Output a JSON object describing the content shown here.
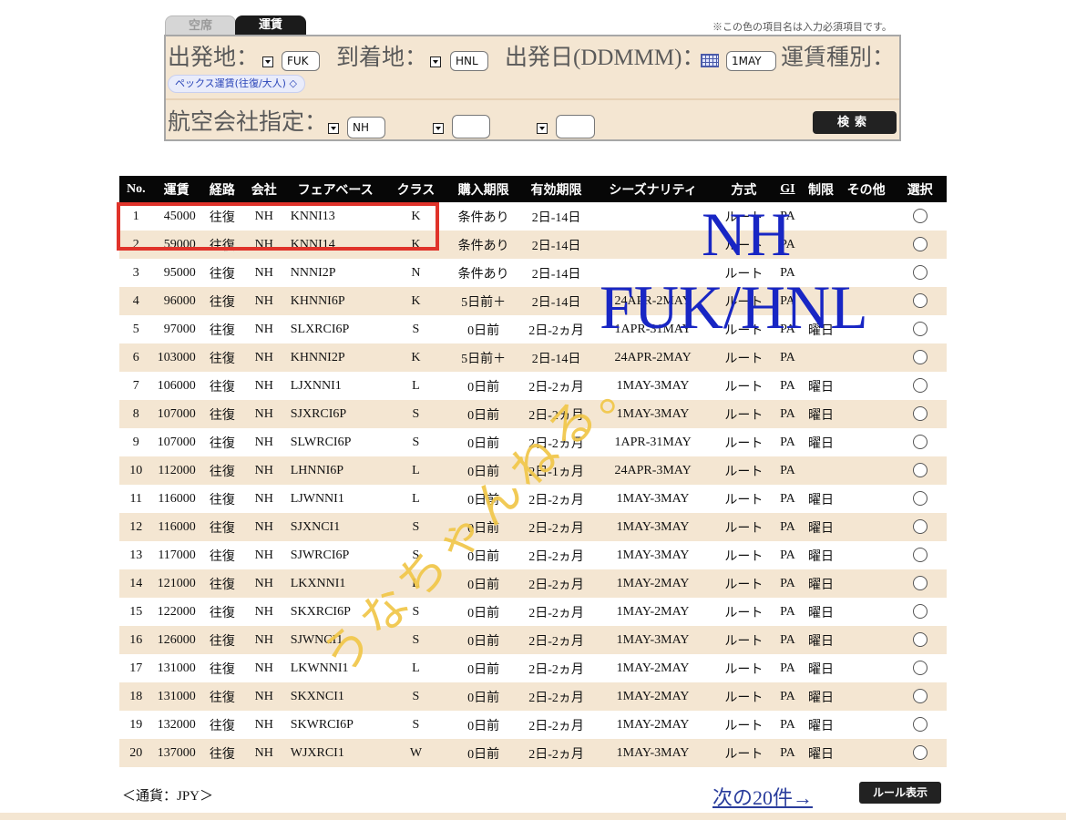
{
  "tabs": {
    "seat": "空席",
    "fare": "運賃"
  },
  "note": "※この色の項目名は入力必須項目です。",
  "search": {
    "origin_label": "出発地：",
    "origin_value": "FUK",
    "dest_label": "到着地：",
    "dest_value": "HNL",
    "date_label": "出発日(DDMMM)：",
    "date_value": "1MAY",
    "faretype_label": "運賃種別：",
    "faretype_value": "ペックス運賃(往復/大人) ◇",
    "airline_label": "航空会社指定：",
    "airline_value": "NH",
    "airline2_value": "",
    "airline3_value": "",
    "search_button": "検索"
  },
  "table": {
    "headers": [
      "No.",
      "運賃",
      "経路",
      "会社",
      "フェアベース",
      "クラス",
      "購入期限",
      "有効期限",
      "シーズナリティ",
      "方式",
      "GI",
      "制限",
      "その他",
      "選択"
    ],
    "rows": [
      [
        "1",
        "45000",
        "往復",
        "NH",
        "KNNI13",
        "K",
        "条件あり",
        "2日-14日",
        "",
        "ルート",
        "PA",
        "",
        ""
      ],
      [
        "2",
        "59000",
        "往復",
        "NH",
        "KNNI14",
        "K",
        "条件あり",
        "2日-14日",
        "",
        "ルート",
        "PA",
        "",
        ""
      ],
      [
        "3",
        "95000",
        "往復",
        "NH",
        "NNNI2P",
        "N",
        "条件あり",
        "2日-14日",
        "",
        "ルート",
        "PA",
        "",
        ""
      ],
      [
        "4",
        "96000",
        "往復",
        "NH",
        "KHNNI6P",
        "K",
        "5日前＋",
        "2日-14日",
        "24APR-2MAY",
        "ルート",
        "PA",
        "",
        ""
      ],
      [
        "5",
        "97000",
        "往復",
        "NH",
        "SLXRCI6P",
        "S",
        "0日前",
        "2日-2ヵ月",
        "1APR-31MAY",
        "ルート",
        "PA",
        "曜日",
        ""
      ],
      [
        "6",
        "103000",
        "往復",
        "NH",
        "KHNNI2P",
        "K",
        "5日前＋",
        "2日-14日",
        "24APR-2MAY",
        "ルート",
        "PA",
        "",
        ""
      ],
      [
        "7",
        "106000",
        "往復",
        "NH",
        "LJXNNI1",
        "L",
        "0日前",
        "2日-2ヵ月",
        "1MAY-3MAY",
        "ルート",
        "PA",
        "曜日",
        ""
      ],
      [
        "8",
        "107000",
        "往復",
        "NH",
        "SJXRCI6P",
        "S",
        "0日前",
        "2日-2ヵ月",
        "1MAY-3MAY",
        "ルート",
        "PA",
        "曜日",
        ""
      ],
      [
        "9",
        "107000",
        "往復",
        "NH",
        "SLWRCI6P",
        "S",
        "0日前",
        "2日-2ヵ月",
        "1APR-31MAY",
        "ルート",
        "PA",
        "曜日",
        ""
      ],
      [
        "10",
        "112000",
        "往復",
        "NH",
        "LHNNI6P",
        "L",
        "0日前",
        "2日-1ヵ月",
        "24APR-3MAY",
        "ルート",
        "PA",
        "",
        ""
      ],
      [
        "11",
        "116000",
        "往復",
        "NH",
        "LJWNNI1",
        "L",
        "0日前",
        "2日-2ヵ月",
        "1MAY-3MAY",
        "ルート",
        "PA",
        "曜日",
        ""
      ],
      [
        "12",
        "116000",
        "往復",
        "NH",
        "SJXNCI1",
        "S",
        "0日前",
        "2日-2ヵ月",
        "1MAY-3MAY",
        "ルート",
        "PA",
        "曜日",
        ""
      ],
      [
        "13",
        "117000",
        "往復",
        "NH",
        "SJWRCI6P",
        "S",
        "0日前",
        "2日-2ヵ月",
        "1MAY-3MAY",
        "ルート",
        "PA",
        "曜日",
        ""
      ],
      [
        "14",
        "121000",
        "往復",
        "NH",
        "LKXNNI1",
        "L",
        "0日前",
        "2日-2ヵ月",
        "1MAY-2MAY",
        "ルート",
        "PA",
        "曜日",
        ""
      ],
      [
        "15",
        "122000",
        "往復",
        "NH",
        "SKXRCI6P",
        "S",
        "0日前",
        "2日-2ヵ月",
        "1MAY-2MAY",
        "ルート",
        "PA",
        "曜日",
        ""
      ],
      [
        "16",
        "126000",
        "往復",
        "NH",
        "SJWNCI1",
        "S",
        "0日前",
        "2日-2ヵ月",
        "1MAY-3MAY",
        "ルート",
        "PA",
        "曜日",
        ""
      ],
      [
        "17",
        "131000",
        "往復",
        "NH",
        "LKWNNI1",
        "L",
        "0日前",
        "2日-2ヵ月",
        "1MAY-2MAY",
        "ルート",
        "PA",
        "曜日",
        ""
      ],
      [
        "18",
        "131000",
        "往復",
        "NH",
        "SKXNCI1",
        "S",
        "0日前",
        "2日-2ヵ月",
        "1MAY-2MAY",
        "ルート",
        "PA",
        "曜日",
        ""
      ],
      [
        "19",
        "132000",
        "往復",
        "NH",
        "SKWRCI6P",
        "S",
        "0日前",
        "2日-2ヵ月",
        "1MAY-2MAY",
        "ルート",
        "PA",
        "曜日",
        ""
      ],
      [
        "20",
        "137000",
        "往復",
        "NH",
        "WJXRCI1",
        "W",
        "0日前",
        "2日-2ヵ月",
        "1MAY-3MAY",
        "ルート",
        "PA",
        "曜日",
        ""
      ]
    ]
  },
  "footer": {
    "currency": "＜通貨：JPY＞",
    "next_link": "次の20件→",
    "rule_button": "ルール表示"
  },
  "overlay": {
    "line1": "NH",
    "line2": "FUK/HNL",
    "handwriting": "うなちゃんねる。"
  },
  "colors": {
    "panel_bg": "#f4e6d2",
    "header_bg": "#070707",
    "overlay_blue": "#1826c4",
    "highlight_red": "#e0332a",
    "handwriting_yellow": "#f1c74a"
  }
}
